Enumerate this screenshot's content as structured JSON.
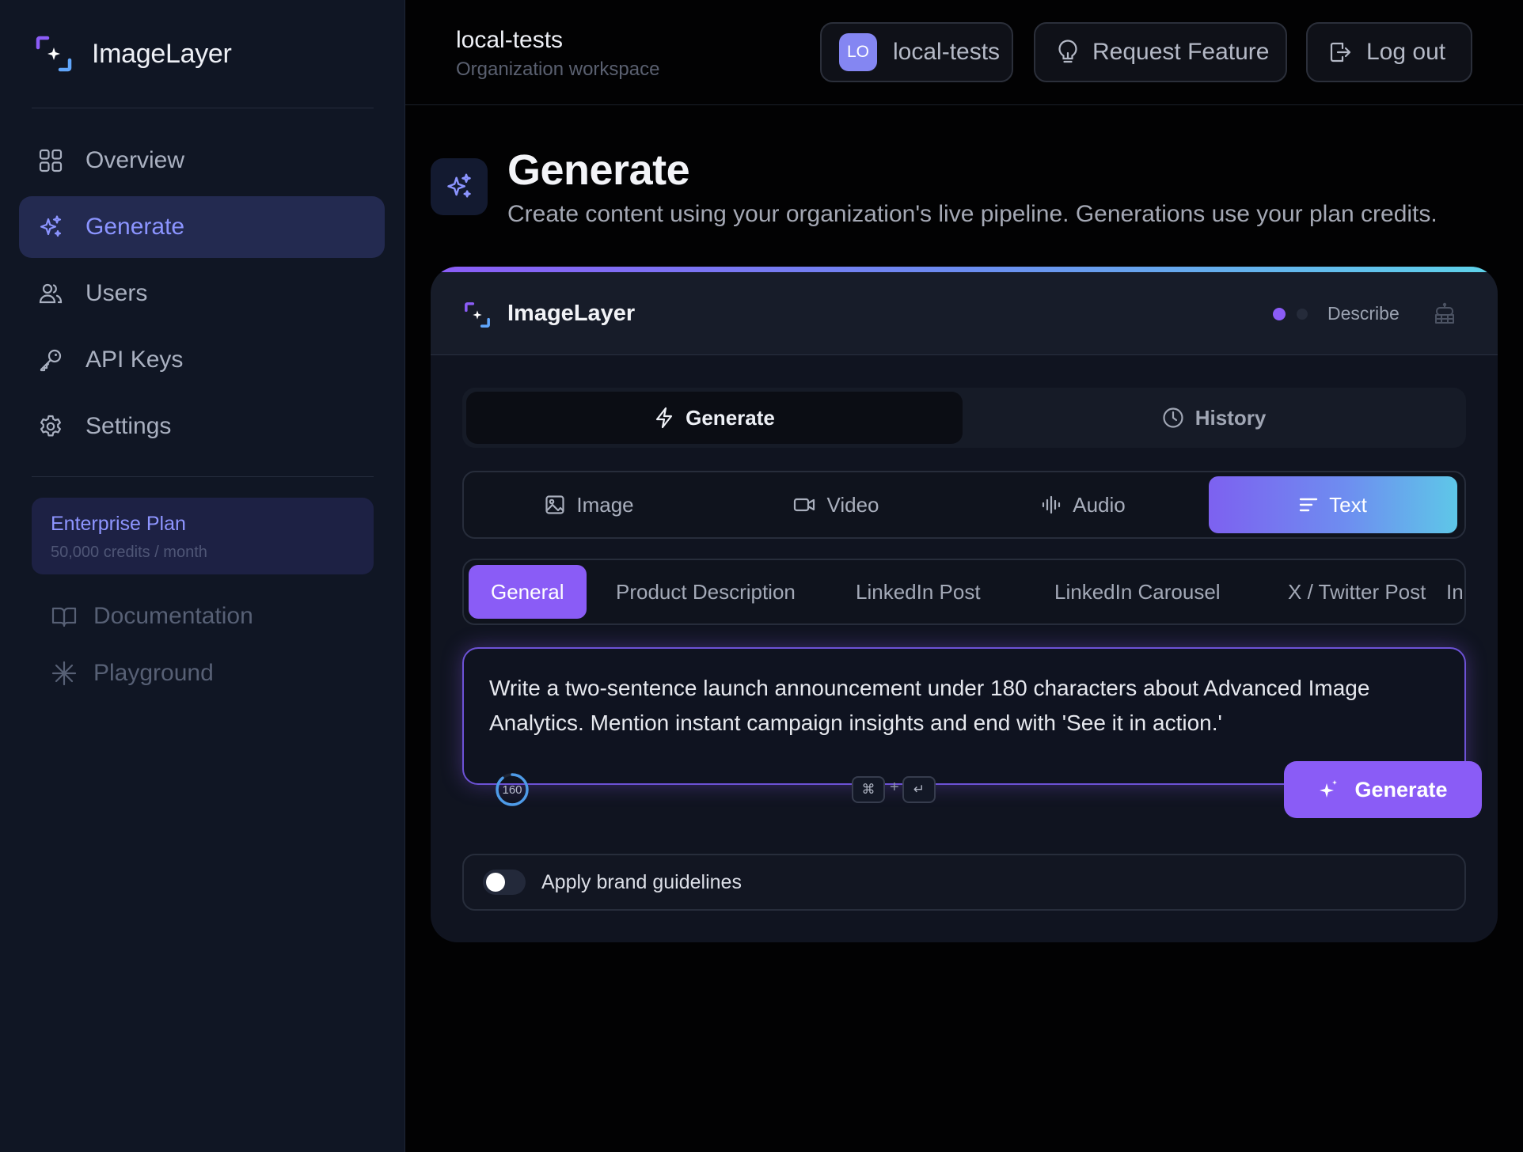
{
  "app": {
    "name": "ImageLayer"
  },
  "sidebar": {
    "nav": [
      {
        "label": "Overview",
        "icon": "grid-icon",
        "active": false
      },
      {
        "label": "Generate",
        "icon": "sparkles-icon",
        "active": true
      },
      {
        "label": "Users",
        "icon": "users-icon",
        "active": false
      },
      {
        "label": "API Keys",
        "icon": "key-icon",
        "active": false
      },
      {
        "label": "Settings",
        "icon": "gear-icon",
        "active": false
      }
    ],
    "plan": {
      "name": "Enterprise Plan",
      "credits": "50,000 credits / month"
    },
    "links": [
      {
        "label": "Documentation",
        "icon": "book-icon"
      },
      {
        "label": "Playground",
        "icon": "asterisk-icon"
      }
    ]
  },
  "topbar": {
    "org_name": "local-tests",
    "org_sub": "Organization workspace",
    "workspace_badge": "LO",
    "workspace_label": "local-tests",
    "request_feature": "Request Feature",
    "logout": "Log out"
  },
  "page": {
    "title": "Generate",
    "subtitle": "Create content using your organization's live pipeline. Generations use your plan credits."
  },
  "card": {
    "title": "ImageLayer",
    "describe": "Describe",
    "mode_tabs": [
      {
        "label": "Generate",
        "icon": "lightning-icon",
        "active": true
      },
      {
        "label": "History",
        "icon": "clock-icon",
        "active": false
      }
    ],
    "media_types": [
      {
        "label": "Image",
        "icon": "image-icon",
        "active": false
      },
      {
        "label": "Video",
        "icon": "video-icon",
        "active": false
      },
      {
        "label": "Audio",
        "icon": "audio-wave-icon",
        "active": false
      },
      {
        "label": "Text",
        "icon": "text-lines-icon",
        "active": true
      }
    ],
    "presets": [
      "General",
      "Product Description",
      "LinkedIn Post",
      "LinkedIn Carousel",
      "X / Twitter Post",
      "In"
    ],
    "active_preset": "General",
    "prompt": "Write a two-sentence launch announcement under 180 characters about Advanced Image Analytics. Mention instant campaign insights and end with 'See it in action.'",
    "char_count": "160",
    "char_count_fraction": 0.89,
    "shortcut": {
      "key1": "⌘",
      "plus": "+",
      "key2": "↵"
    },
    "generate_button": "Generate",
    "brand_guidelines": {
      "label": "Apply brand guidelines",
      "enabled": false
    }
  },
  "colors": {
    "accent": "#8a5cf6",
    "sidebar_bg": "#101624",
    "page_bg": "#020203",
    "nav_active_bg": "#232a50",
    "nav_active_text": "#8b94ff"
  }
}
